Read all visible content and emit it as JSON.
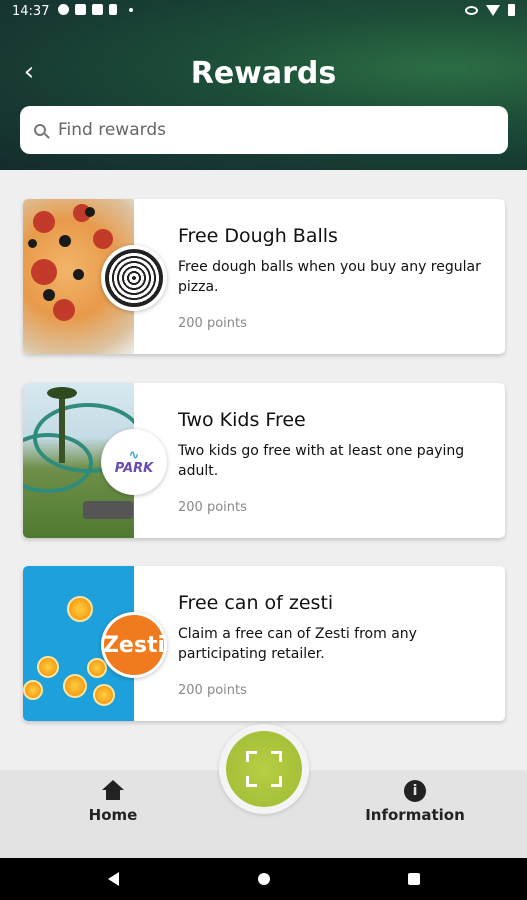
{
  "status_bar": {
    "time": "14:37"
  },
  "header": {
    "title": "Rewards",
    "back_icon": "chevron-left-icon"
  },
  "search": {
    "placeholder": "Find rewards"
  },
  "rewards": [
    {
      "title": "Free Dough Balls",
      "description": "Free dough balls when you buy any regular pizza.",
      "points": "200 points",
      "logo_text": ""
    },
    {
      "title": "Two Kids Free",
      "description": "Two kids go free with at least one paying adult.",
      "points": "200 points",
      "logo_text": ""
    },
    {
      "title": "Free can of zesti",
      "description": "Claim a free can of Zesti from any participating retailer.",
      "points": "200 points",
      "logo_text": "Zesti"
    }
  ],
  "bottom_nav": {
    "home_label": "Home",
    "info_label": "Information"
  },
  "colors": {
    "header_dark": "#142c2c",
    "header_green": "#2c6e44",
    "scan_button": "#b5cf45",
    "zesti_orange": "#f07a1e"
  }
}
